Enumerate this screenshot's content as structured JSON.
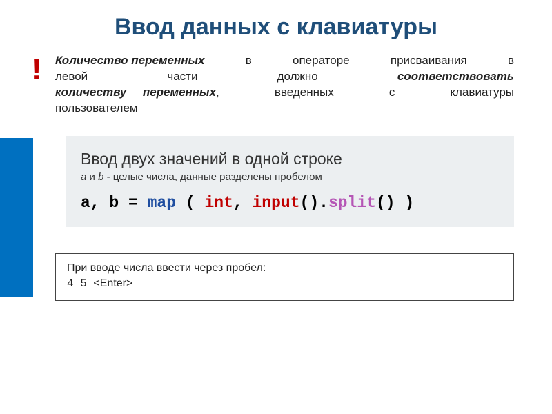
{
  "title": "Ввод данных с клавиатуры",
  "bang": "!",
  "callout": {
    "r1a": "Количество переменных",
    "r1b": "в",
    "r1c": "операторе",
    "r1d": "присваивания",
    "r1e": "в",
    "r2a": "левой",
    "r2b": "части",
    "r2c": "должно",
    "r2d": "соответствовать",
    "r3a": "количеству",
    "r3b": "переменных",
    "r3c": ",",
    "r3d": "введенных",
    "r3e": "с",
    "r3f": "клавиатуры",
    "r4": "пользователем"
  },
  "codebox": {
    "heading": "Ввод двух значений в одной строке",
    "sub_i1": "a",
    "sub_t1": " и ",
    "sub_i2": "b",
    "sub_t2": " - целые числа, данные разделены пробелом",
    "code_pre": "a, b = ",
    "code_map": "map",
    "code_mid1": " ( ",
    "code_int": "int",
    "code_mid2": ", ",
    "code_input": "input",
    "code_mid3": "().",
    "code_split": "split",
    "code_end": "() )"
  },
  "example": {
    "line1": "При вводе числа ввести через пробел:",
    "line2a": "4 5 ",
    "line2b": "<Enter>"
  }
}
